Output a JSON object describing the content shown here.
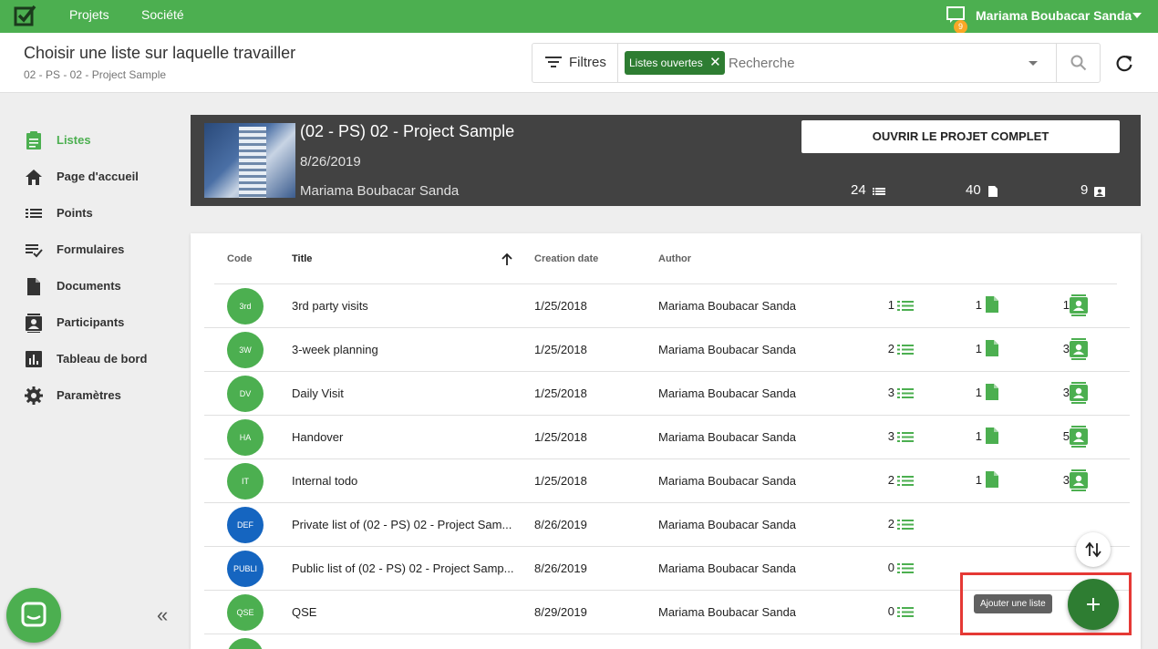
{
  "topbar": {
    "nav": [
      "Projets",
      "Société"
    ],
    "notification_count": "9",
    "user_name": "Mariama Boubacar Sanda"
  },
  "header": {
    "title": "Choisir une liste sur laquelle travailler",
    "breadcrumb": "02 - PS - 02 - Project Sample",
    "filters_label": "Filtres",
    "chip_label": "Listes ouvertes",
    "search_placeholder": "Recherche"
  },
  "sidebar": {
    "items": [
      {
        "label": "Listes",
        "icon": "clipboard-icon",
        "active": true
      },
      {
        "label": "Page d'accueil",
        "icon": "home-icon"
      },
      {
        "label": "Points",
        "icon": "list-icon"
      },
      {
        "label": "Formulaires",
        "icon": "checklist-icon"
      },
      {
        "label": "Documents",
        "icon": "document-icon"
      },
      {
        "label": "Participants",
        "icon": "contacts-icon"
      },
      {
        "label": "Tableau de bord",
        "icon": "chart-icon"
      },
      {
        "label": "Paramètres",
        "icon": "gear-icon"
      }
    ],
    "collapse_glyph": "«"
  },
  "project": {
    "title": "(02 - PS) 02 - Project Sample",
    "date": "8/26/2019",
    "author": "Mariama Boubacar Sanda",
    "open_button": "OUVRIR LE PROJET COMPLET",
    "stats": {
      "lists": "24",
      "documents": "40",
      "participants": "9"
    }
  },
  "table": {
    "headers": {
      "code": "Code",
      "title": "Title",
      "date": "Creation date",
      "author": "Author"
    },
    "rows": [
      {
        "code": "3rd",
        "color": "#4caf50",
        "title": "3rd party visits",
        "date": "1/25/2018",
        "author": "Mariama Boubacar Sanda",
        "points": "1",
        "docs": "1",
        "participants": "1"
      },
      {
        "code": "3W",
        "color": "#4caf50",
        "title": "3-week planning",
        "date": "1/25/2018",
        "author": "Mariama Boubacar Sanda",
        "points": "2",
        "docs": "1",
        "participants": "3"
      },
      {
        "code": "DV",
        "color": "#4caf50",
        "title": "Daily Visit",
        "date": "1/25/2018",
        "author": "Mariama Boubacar Sanda",
        "points": "3",
        "docs": "1",
        "participants": "3"
      },
      {
        "code": "HA",
        "color": "#4caf50",
        "title": "Handover",
        "date": "1/25/2018",
        "author": "Mariama Boubacar Sanda",
        "points": "3",
        "docs": "1",
        "participants": "5"
      },
      {
        "code": "IT",
        "color": "#4caf50",
        "title": "Internal todo",
        "date": "1/25/2018",
        "author": "Mariama Boubacar Sanda",
        "points": "2",
        "docs": "1",
        "participants": "3"
      },
      {
        "code": "DEF",
        "color": "#1565c0",
        "title": "Private list of (02 - PS) 02 - Project Sam...",
        "date": "8/26/2019",
        "author": "Mariama Boubacar Sanda",
        "points": "2",
        "docs": "",
        "participants": ""
      },
      {
        "code": "PUBLI",
        "color": "#1565c0",
        "title": "Public list of (02 - PS) 02 - Project Samp...",
        "date": "8/26/2019",
        "author": "Mariama Boubacar Sanda",
        "points": "0",
        "docs": "",
        "participants": ""
      },
      {
        "code": "QSE",
        "color": "#4caf50",
        "title": "QSE",
        "date": "8/29/2019",
        "author": "Mariama Boubacar Sanda",
        "points": "0",
        "docs": "",
        "participants": ""
      }
    ]
  },
  "fab": {
    "tooltip": "Ajouter une liste"
  },
  "colors": {
    "primary": "#4caf50",
    "primary_dark": "#2e7d32",
    "banner": "#424242",
    "highlight": "#e53935"
  }
}
